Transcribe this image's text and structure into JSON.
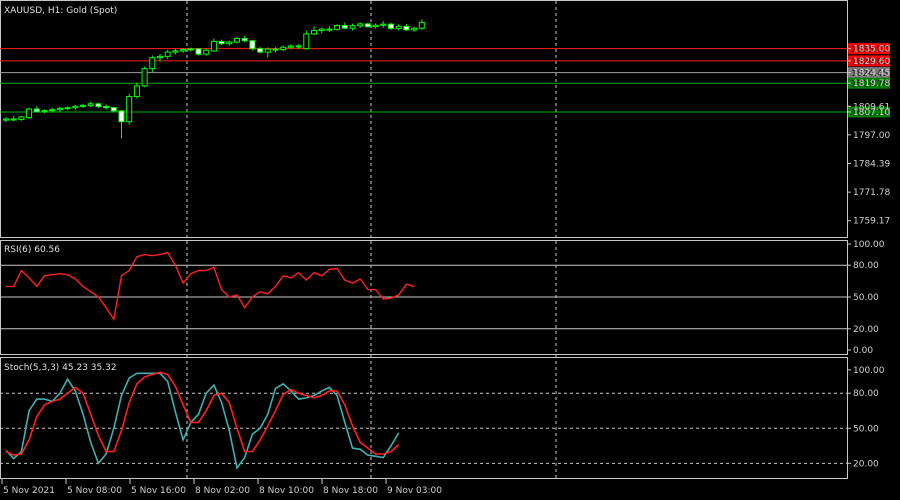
{
  "chart_data": [
    {
      "type": "candlestick",
      "title": "XAUUSD, H1:  Gold (Spot)",
      "y_ticks": [
        "1835.00",
        "1829.60",
        "1824.45",
        "1819.78",
        "1809.61",
        "1807.10",
        "1797.00",
        "1784.39",
        "1771.78",
        "1759.17"
      ],
      "price_levels": [
        {
          "value": "1835.00",
          "color": "#ff2020",
          "label_bg": "#ff0000"
        },
        {
          "value": "1829.60",
          "color": "#ff2020",
          "label_bg": "#ff0000"
        },
        {
          "value": "1824.45",
          "color": "#a0a0a0",
          "label_bg": "#7a7a7a"
        },
        {
          "value": "1819.78",
          "color": "#00b000",
          "label_bg": "#008000"
        },
        {
          "value": "1807.10",
          "color": "#00b000",
          "label_bg": "#008000"
        }
      ],
      "candles": [
        [
          1803.5,
          1804.8,
          1802.6,
          1804.0
        ],
        [
          1804.0,
          1805.3,
          1803.0,
          1803.8
        ],
        [
          1803.8,
          1805.5,
          1803.2,
          1804.9
        ],
        [
          1804.6,
          1809.0,
          1804.0,
          1808.4
        ],
        [
          1808.4,
          1809.6,
          1806.9,
          1807.2
        ],
        [
          1807.3,
          1808.3,
          1806.5,
          1807.7
        ],
        [
          1807.7,
          1809.0,
          1806.8,
          1808.1
        ],
        [
          1808.1,
          1809.4,
          1807.2,
          1808.7
        ],
        [
          1808.6,
          1809.5,
          1807.8,
          1809.0
        ],
        [
          1809.0,
          1810.2,
          1808.3,
          1809.6
        ],
        [
          1809.6,
          1810.6,
          1808.9,
          1810.0
        ],
        [
          1810.0,
          1811.6,
          1809.3,
          1810.7
        ],
        [
          1810.7,
          1811.2,
          1808.8,
          1809.5
        ],
        [
          1809.5,
          1810.5,
          1808.2,
          1809.0
        ],
        [
          1809.0,
          1809.4,
          1806.9,
          1807.6
        ],
        [
          1807.6,
          1808.0,
          1795.4,
          1802.8
        ],
        [
          1802.8,
          1815.0,
          1801.5,
          1813.9
        ],
        [
          1813.9,
          1820.0,
          1813.0,
          1818.6
        ],
        [
          1818.6,
          1827.0,
          1818.0,
          1826.2
        ],
        [
          1826.2,
          1832.0,
          1824.8,
          1831.0
        ],
        [
          1831.0,
          1832.7,
          1829.3,
          1831.6
        ],
        [
          1831.6,
          1834.4,
          1830.5,
          1833.5
        ],
        [
          1833.5,
          1835.0,
          1832.5,
          1834.0
        ],
        [
          1834.0,
          1835.2,
          1833.1,
          1834.6
        ],
        [
          1834.6,
          1835.5,
          1833.8,
          1834.9
        ],
        [
          1834.9,
          1835.2,
          1832.0,
          1832.6
        ],
        [
          1832.6,
          1835.0,
          1831.9,
          1834.3
        ],
        [
          1834.0,
          1839.5,
          1833.5,
          1838.2
        ],
        [
          1838.2,
          1839.0,
          1836.5,
          1837.2
        ],
        [
          1837.2,
          1838.6,
          1836.3,
          1837.9
        ],
        [
          1837.9,
          1840.1,
          1837.2,
          1839.5
        ],
        [
          1839.5,
          1840.6,
          1837.8,
          1838.5
        ],
        [
          1838.5,
          1838.9,
          1834.2,
          1835.0
        ],
        [
          1835.0,
          1835.8,
          1832.9,
          1833.5
        ],
        [
          1833.5,
          1835.6,
          1831.1,
          1834.8
        ],
        [
          1834.8,
          1835.6,
          1833.3,
          1834.6
        ],
        [
          1834.6,
          1836.4,
          1833.8,
          1835.6
        ],
        [
          1835.6,
          1836.8,
          1834.9,
          1836.2
        ],
        [
          1836.2,
          1837.0,
          1835.0,
          1836.0
        ],
        [
          1835.0,
          1843.0,
          1834.5,
          1841.5
        ],
        [
          1841.5,
          1844.9,
          1840.9,
          1843.0
        ],
        [
          1843.0,
          1844.3,
          1841.8,
          1843.6
        ],
        [
          1843.6,
          1844.9,
          1842.4,
          1843.5
        ],
        [
          1843.5,
          1845.7,
          1843.0,
          1845.2
        ],
        [
          1845.2,
          1846.5,
          1843.6,
          1844.0
        ],
        [
          1844.0,
          1846.0,
          1843.0,
          1845.1
        ],
        [
          1845.1,
          1846.6,
          1844.2,
          1845.9
        ],
        [
          1845.9,
          1846.4,
          1844.2,
          1844.7
        ],
        [
          1844.7,
          1846.1,
          1843.9,
          1845.3
        ],
        [
          1845.3,
          1847.1,
          1844.3,
          1845.8
        ],
        [
          1845.8,
          1846.4,
          1843.3,
          1843.9
        ],
        [
          1843.9,
          1845.7,
          1843.0,
          1844.8
        ],
        [
          1844.8,
          1845.9,
          1842.8,
          1843.3
        ],
        [
          1843.3,
          1844.6,
          1842.4,
          1844.0
        ],
        [
          1844.0,
          1847.8,
          1843.3,
          1846.6
        ]
      ]
    },
    {
      "type": "line",
      "title": "RSI(6) 60.56",
      "y_ticks": [
        "100.00",
        "80.00",
        "50.00",
        "20.00",
        "0.00"
      ],
      "levels": [
        80,
        50,
        20
      ],
      "series": [
        {
          "color": "#ff2020",
          "values": [
            60,
            60,
            75,
            68,
            60,
            70,
            71,
            72,
            71,
            67,
            60,
            55,
            50,
            40,
            29,
            70,
            75,
            88,
            90,
            89,
            90,
            92,
            80,
            63,
            72,
            75,
            75,
            78,
            57,
            50,
            52,
            40,
            50,
            55,
            53,
            60,
            70,
            68,
            73,
            66,
            73,
            70,
            76,
            77,
            66,
            63,
            67,
            57,
            57,
            48,
            49,
            52,
            62,
            60
          ]
        }
      ]
    },
    {
      "type": "line",
      "title": "Stoch(5,3,3) 45.23 35.32",
      "y_ticks": [
        "100.00",
        "80.00",
        "50.00",
        "20.00"
      ],
      "levels": [
        80,
        50,
        20
      ],
      "series": [
        {
          "color": "#40b0b0",
          "values": [
            31,
            24,
            30,
            65,
            75,
            75,
            73,
            80,
            92,
            82,
            62,
            38,
            20,
            28,
            50,
            78,
            93,
            97,
            97,
            97,
            97,
            90,
            64,
            40,
            55,
            62,
            80,
            87,
            72,
            48,
            16,
            25,
            45,
            50,
            62,
            84,
            88,
            82,
            75,
            76,
            78,
            82,
            85,
            78,
            55,
            33,
            32,
            27,
            26,
            25,
            35,
            46
          ]
        },
        {
          "color": "#ff2020",
          "values": [
            30,
            27,
            28,
            40,
            60,
            70,
            73,
            75,
            80,
            85,
            80,
            62,
            44,
            30,
            30,
            48,
            72,
            88,
            94,
            96,
            98,
            96,
            86,
            70,
            55,
            55,
            65,
            78,
            80,
            72,
            50,
            30,
            30,
            40,
            52,
            65,
            79,
            83,
            80,
            78,
            76,
            78,
            82,
            82,
            70,
            52,
            38,
            33,
            28,
            28,
            30,
            36
          ]
        }
      ]
    }
  ],
  "time_axis": {
    "labels": [
      "5 Nov 2021",
      "5 Nov 08:00",
      "5 Nov 16:00",
      "8 Nov 02:00",
      "8 Nov 10:00",
      "8 Nov 18:00",
      "9 Nov 03:00"
    ],
    "separator_labels": [
      "5 Nov 16:00",
      "8 Nov 18:00",
      "9 Nov 03:00"
    ]
  },
  "colors": {
    "background": "#000000",
    "grid": "#c8c8c8",
    "candle": "#00ff00",
    "rsi": "#ff2020",
    "stoch_main": "#40b0b0",
    "stoch_signal": "#ff2020"
  }
}
